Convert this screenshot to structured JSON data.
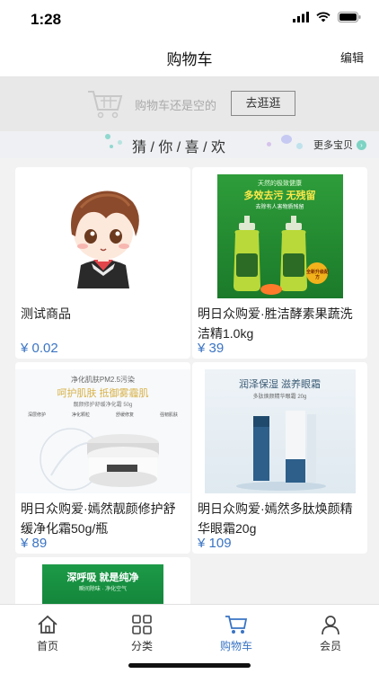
{
  "status": {
    "time": "1:28"
  },
  "header": {
    "title": "购物车",
    "edit_label": "编辑"
  },
  "empty_cart": {
    "message": "购物车还是空的",
    "button_label": "去逛逛"
  },
  "recommend": {
    "title": "猜 / 你 / 喜 / 欢",
    "more_label": "更多宝贝",
    "more_icon": "chevron-right-icon"
  },
  "products": [
    {
      "name": "测试商品",
      "price": "¥ 0.02",
      "image": "cartoon-boy-avatar"
    },
    {
      "name": "明日众购爱·胜洁酵素果蔬洗洁精1.0kg",
      "price": "¥ 39",
      "image": "dish-soap-bottles",
      "img_text": {
        "line1": "天然的极致健康",
        "line2": "多效去污 无残留",
        "line3": "去除有人害物质残留",
        "badge": "全新升级配方"
      }
    },
    {
      "name": "明日众购爱·嫣然靓颜修护舒缓净化霜50g/瓶",
      "price": "¥ 89",
      "image": "face-cream-jar",
      "img_text": {
        "line1": "净化肌肤PM2.5污染",
        "line2": "呵护肌肤  抵御雾霾肌",
        "line3": "靓颜修护舒缓净化霜 50g",
        "tags": [
          "深层修护",
          "净化颗粒",
          "舒缓修复",
          "强韧肌肤"
        ]
      }
    },
    {
      "name": "明日众购爱·嫣然多肽焕颜精华眼霜20g",
      "price": "¥ 109",
      "image": "eye-cream-tube",
      "img_text": {
        "line1": "润泽保湿  滋养眼霜",
        "line2": "多肽焕颜精华眼霜 20g"
      }
    },
    {
      "name": "",
      "price": "",
      "image": "green-product-banner",
      "img_text": {
        "line1": "深呼吸 就是纯净",
        "line2": "瞬间除味 · 净化空气"
      }
    }
  ],
  "tabs": [
    {
      "label": "首页",
      "icon": "home-icon"
    },
    {
      "label": "分类",
      "icon": "grid-icon"
    },
    {
      "label": "购物车",
      "icon": "cart-icon",
      "active": true
    },
    {
      "label": "会员",
      "icon": "user-icon"
    }
  ],
  "colors": {
    "accent": "#3a74c4",
    "price": "#3a74c4",
    "tab_active": "#3a74c4"
  }
}
